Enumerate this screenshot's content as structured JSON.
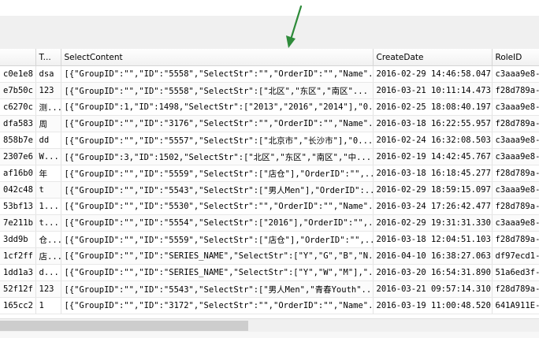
{
  "grid": {
    "columns": [
      "",
      "T...",
      "SelectContent",
      "CreateDate",
      "RoleID"
    ],
    "rows": [
      [
        "c0e1e8",
        "dsa",
        "[{\"GroupID\":\"\",\"ID\":\"5558\",\"SelectStr\":\"\",\"OrderID\":\"\",\"Name\"...",
        "2016-02-29 14:46:58.047",
        "c3aaa9e8-"
      ],
      [
        "e7b50c",
        "123",
        "[{\"GroupID\":\"\",\"ID\":\"5558\",\"SelectStr\":[\"北区\",\"东区\",\"南区\"...",
        "2016-03-21 10:11:14.473",
        "f28d789a-"
      ],
      [
        "c6270c",
        "测...",
        "[{\"GroupID\":1,\"ID\":1498,\"SelectStr\":[\"2013\",\"2016\",\"2014\"],\"0...",
        "2016-02-25 18:08:40.197",
        "c3aaa9e8-"
      ],
      [
        "dfa583",
        "周",
        "[{\"GroupID\":\"\",\"ID\":\"3176\",\"SelectStr\":\"\",\"OrderID\":\"\",\"Name\"...",
        "2016-03-18 16:22:55.957",
        "f28d789a-"
      ],
      [
        "858b7e",
        "dd",
        "[{\"GroupID\":\"\",\"ID\":\"5557\",\"SelectStr\":[\"北京市\",\"长沙市\"],\"0...",
        "2016-02-24 16:32:08.503",
        "c3aaa9e8-"
      ],
      [
        "2307e6",
        "W...",
        "[{\"GroupID\":3,\"ID\":1502,\"SelectStr\":[\"北区\",\"东区\",\"南区\",\"中...",
        "2016-02-19 14:42:45.767",
        "c3aaa9e8-"
      ],
      [
        "af16b0",
        "年",
        "[{\"GroupID\":\"\",\"ID\":\"5559\",\"SelectStr\":[\"店仓\"],\"OrderID\":\"\",...",
        "2016-03-18 16:18:45.277",
        "f28d789a-"
      ],
      [
        "042c48",
        "t",
        "[{\"GroupID\":\"\",\"ID\":\"5543\",\"SelectStr\":[\"男人Men\"],\"OrderID\":...",
        "2016-02-29 18:59:15.097",
        "c3aaa9e8-"
      ],
      [
        "53bf13",
        "1...",
        "[{\"GroupID\":\"\",\"ID\":\"5530\",\"SelectStr\":\"\",\"OrderID\":\"\",\"Name\"...",
        "2016-03-24 17:26:42.477",
        "f28d789a-"
      ],
      [
        "7e211b",
        "t...",
        "[{\"GroupID\":\"\",\"ID\":\"5554\",\"SelectStr\":[\"2016\"],\"OrderID\":\"\",...",
        "2016-02-29 19:31:31.330",
        "c3aaa9e8-"
      ],
      [
        "3dd9b",
        "仓...",
        "[{\"GroupID\":\"\",\"ID\":\"5559\",\"SelectStr\":[\"店仓\"],\"OrderID\":\"\",...",
        "2016-03-18 12:04:51.103",
        "f28d789a-"
      ],
      [
        "1cf2ff",
        "店...",
        "[{\"GroupID\":\"\",\"ID\":\"SERIES_NAME\",\"SelectStr\":[\"Y\",\"G\",\"B\",\"N...",
        "2016-04-10 16:38:27.063",
        "df97ecd1-"
      ],
      [
        "1dd1a3",
        "d...",
        "[{\"GroupID\":\"\",\"ID\":\"SERIES_NAME\",\"SelectStr\":[\"Y\",\"W\",\"M\"],\"...",
        "2016-03-20 16:54:31.890",
        "51a6ed3f-"
      ],
      [
        "52f12f",
        "123",
        "[{\"GroupID\":\"\",\"ID\":\"5543\",\"SelectStr\":[\"男人Men\",\"青春Youth\"...",
        "2016-03-21 09:57:14.310",
        "f28d789a-"
      ],
      [
        "165cc2",
        "1",
        "[{\"GroupID\":\"\",\"ID\":\"3172\",\"SelectStr\":\"\",\"OrderID\":\"\",\"Name\"...",
        "2016-03-19 11:00:48.520",
        "641A911E-"
      ]
    ]
  },
  "scrollbar": {
    "thumb_fraction": 0.46
  },
  "colors": {
    "arrow": "#2e8b3a",
    "header_bg": "#f5f5f5",
    "scroll_thumb": "#cdcdcd"
  }
}
